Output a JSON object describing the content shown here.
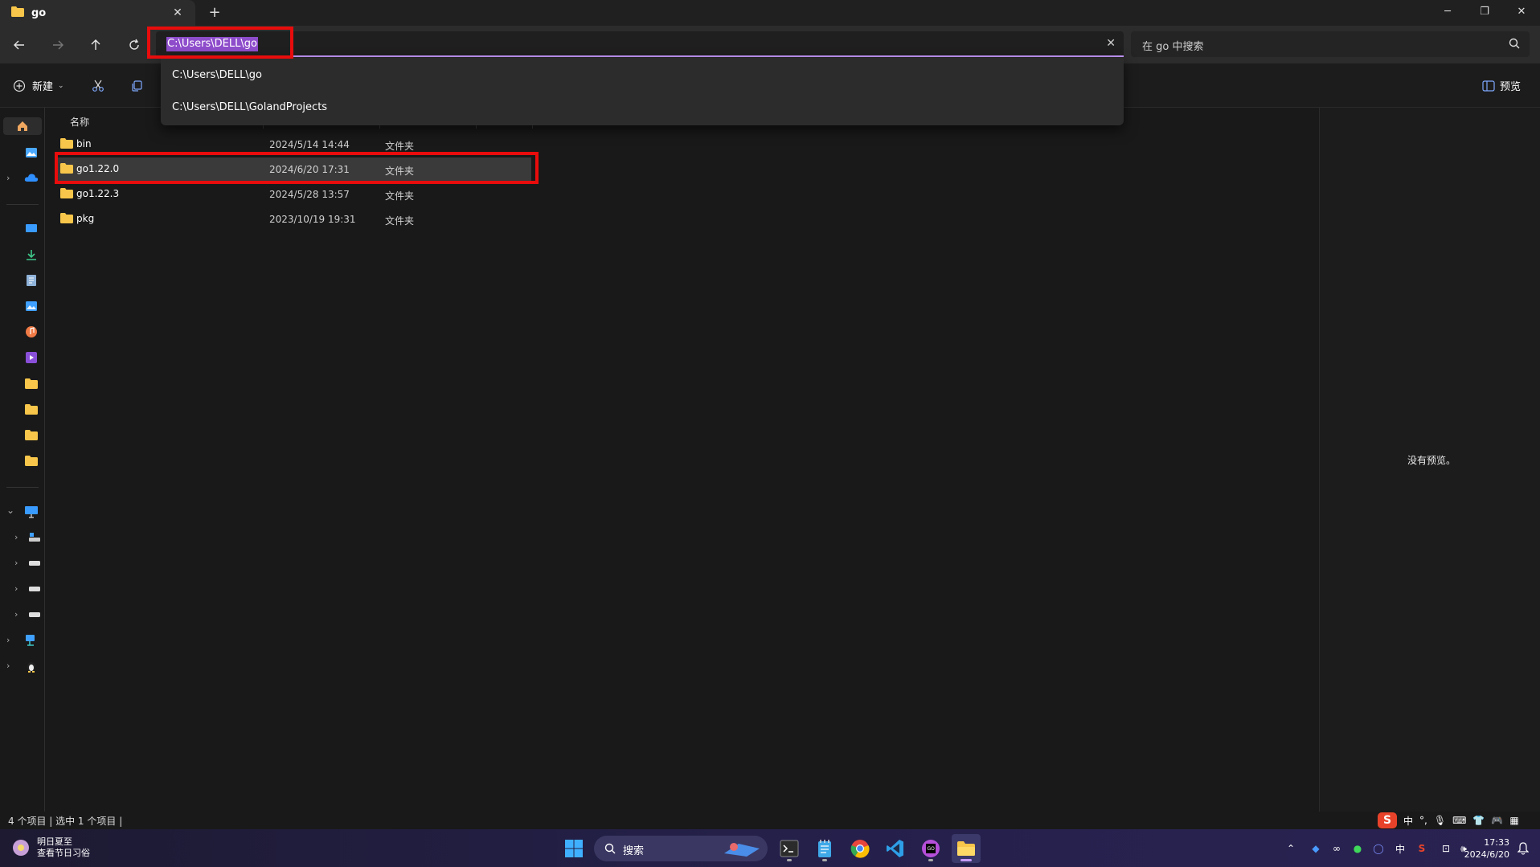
{
  "window": {
    "tab_title": "go",
    "minimize": "─",
    "restore": "❐",
    "close": "✕"
  },
  "navbar": {
    "address": "C:\\Users\\DELL\\go",
    "search_placeholder": "在 go 中搜索"
  },
  "address_dropdown": [
    "C:\\Users\\DELL\\go",
    "C:\\Users\\DELL\\GolandProjects"
  ],
  "toolbar": {
    "new_label": "新建",
    "preview_label": "预览"
  },
  "columns": {
    "name": "名称"
  },
  "files": [
    {
      "name": "bin",
      "date": "2024/5/14 14:44",
      "type": "文件夹",
      "selected": false
    },
    {
      "name": "go1.22.0",
      "date": "2024/6/20 17:31",
      "type": "文件夹",
      "selected": true
    },
    {
      "name": "go1.22.3",
      "date": "2024/5/28 13:57",
      "type": "文件夹",
      "selected": false
    },
    {
      "name": "pkg",
      "date": "2023/10/19 19:31",
      "type": "文件夹",
      "selected": false
    }
  ],
  "preview_pane": {
    "message": "没有预览。"
  },
  "statusbar": {
    "text": "4 个项目  |  选中 1 个项目  |"
  },
  "taskbar": {
    "weather_title": "明日夏至",
    "weather_subtitle": "查看节日习俗",
    "search_label": "搜索",
    "ime_lang": "中",
    "clock_time": "17:33",
    "clock_date": "2024/6/20"
  },
  "colors": {
    "accent": "#8e4dcb",
    "folder": "#f7c64a",
    "annotation": "#e80c0c"
  }
}
